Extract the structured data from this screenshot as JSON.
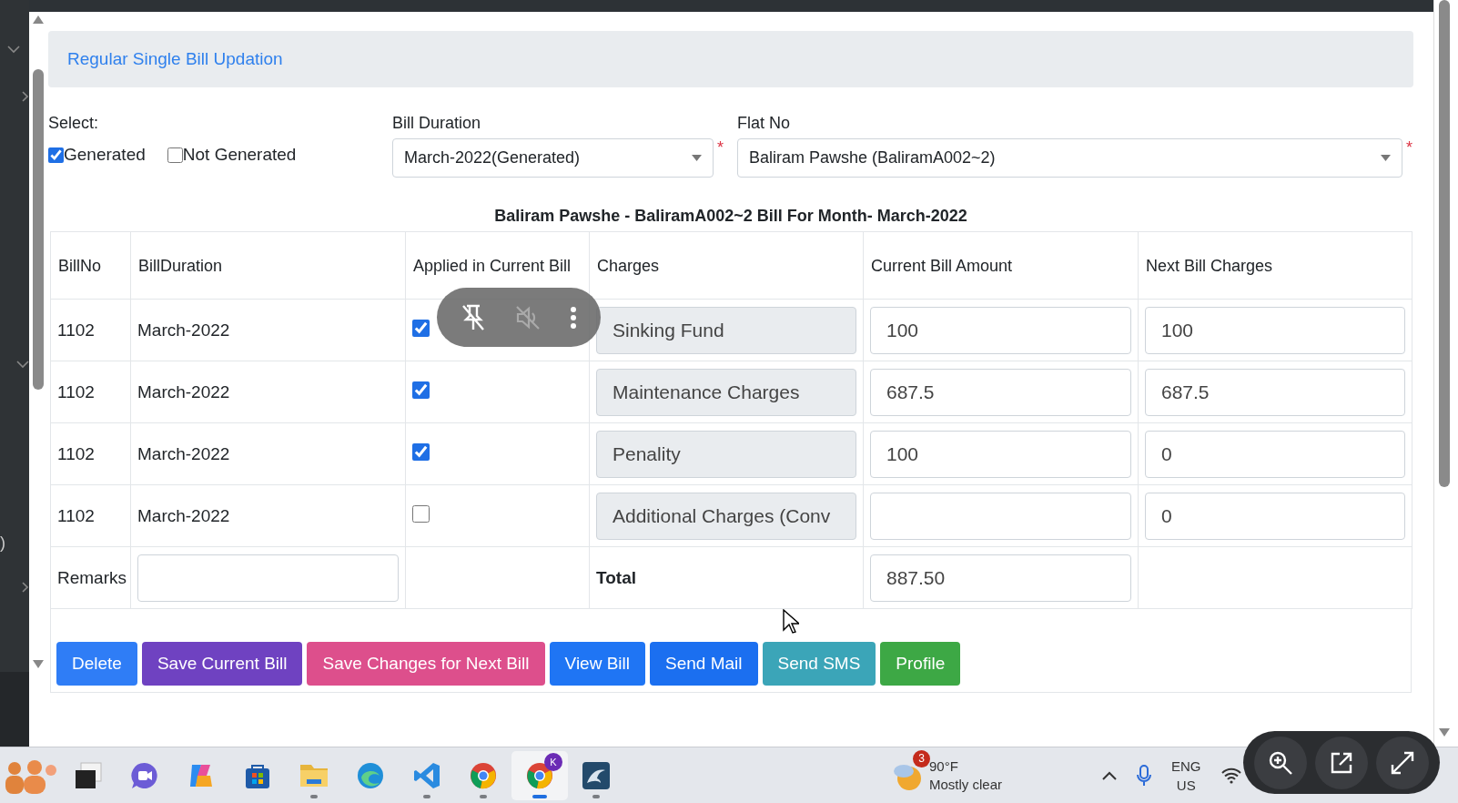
{
  "sidebar": {
    "fragment": ")"
  },
  "header": {
    "title": "Regular Single Bill Updation"
  },
  "filters": {
    "select_label": "Select:",
    "options": [
      {
        "label": "Generated",
        "checked": true
      },
      {
        "label": "Not Generated",
        "checked": false
      }
    ],
    "bill_duration": {
      "label": "Bill Duration",
      "value": "March-2022(Generated)",
      "required_mark": "*"
    },
    "flat_no": {
      "label": "Flat No",
      "value": "Baliram Pawshe (BaliramA002~2)",
      "required_mark": "*"
    }
  },
  "table": {
    "title": "Baliram Pawshe - BaliramA002~2 Bill For Month- March-2022",
    "columns": [
      "BillNo",
      "BillDuration",
      "Applied in Current Bill",
      "Charges",
      "Current Bill Amount",
      "Next Bill Charges"
    ],
    "rows": [
      {
        "bill_no": "1102",
        "bill_duration": "March-2022",
        "applied": true,
        "charge": "Sinking Fund",
        "current_amount": "100",
        "next_charges": "100"
      },
      {
        "bill_no": "1102",
        "bill_duration": "March-2022",
        "applied": true,
        "charge": "Maintenance Charges",
        "current_amount": "687.5",
        "next_charges": "687.5"
      },
      {
        "bill_no": "1102",
        "bill_duration": "March-2022",
        "applied": true,
        "charge": "Penality",
        "current_amount": "100",
        "next_charges": "0"
      },
      {
        "bill_no": "1102",
        "bill_duration": "March-2022",
        "applied": false,
        "charge": "Additional Charges (Conv",
        "next_charges": "0"
      }
    ],
    "remarks_label": "Remarks",
    "total_label": "Total",
    "total_value": "887.50"
  },
  "buttons": [
    {
      "label": "Delete",
      "color": "#2f7df6"
    },
    {
      "label": "Save Current Bill",
      "color": "#6f42c1"
    },
    {
      "label": "Save Changes for Next Bill",
      "color": "#dd4f8c"
    },
    {
      "label": "View Bill",
      "color": "#1f75f4"
    },
    {
      "label": "Send Mail",
      "color": "#1b6ff0"
    },
    {
      "label": "Send SMS",
      "color": "#3ba5b8"
    },
    {
      "label": "Profile",
      "color": "#3da845"
    }
  ],
  "taskbar": {
    "apps": [
      {
        "kind": "widgets",
        "running": false,
        "selected": false
      },
      {
        "kind": "window",
        "running": false,
        "selected": false
      },
      {
        "kind": "chat",
        "running": false,
        "selected": false
      },
      {
        "kind": "swirl",
        "running": false,
        "selected": false
      },
      {
        "kind": "store",
        "running": false,
        "selected": false
      },
      {
        "kind": "folder",
        "running": true,
        "selected": false
      },
      {
        "kind": "wave",
        "running": false,
        "selected": false
      },
      {
        "kind": "code",
        "running": true,
        "selected": false
      },
      {
        "kind": "browser",
        "running": true,
        "selected": false
      },
      {
        "kind": "browser",
        "running": true,
        "selected": true,
        "badge": "K"
      },
      {
        "kind": "dolphin",
        "running": true,
        "selected": false
      }
    ],
    "weather": {
      "badge": "3",
      "temperature": "90°F",
      "condition": "Mostly clear"
    },
    "language": {
      "primary": "ENG",
      "secondary": "US"
    }
  }
}
